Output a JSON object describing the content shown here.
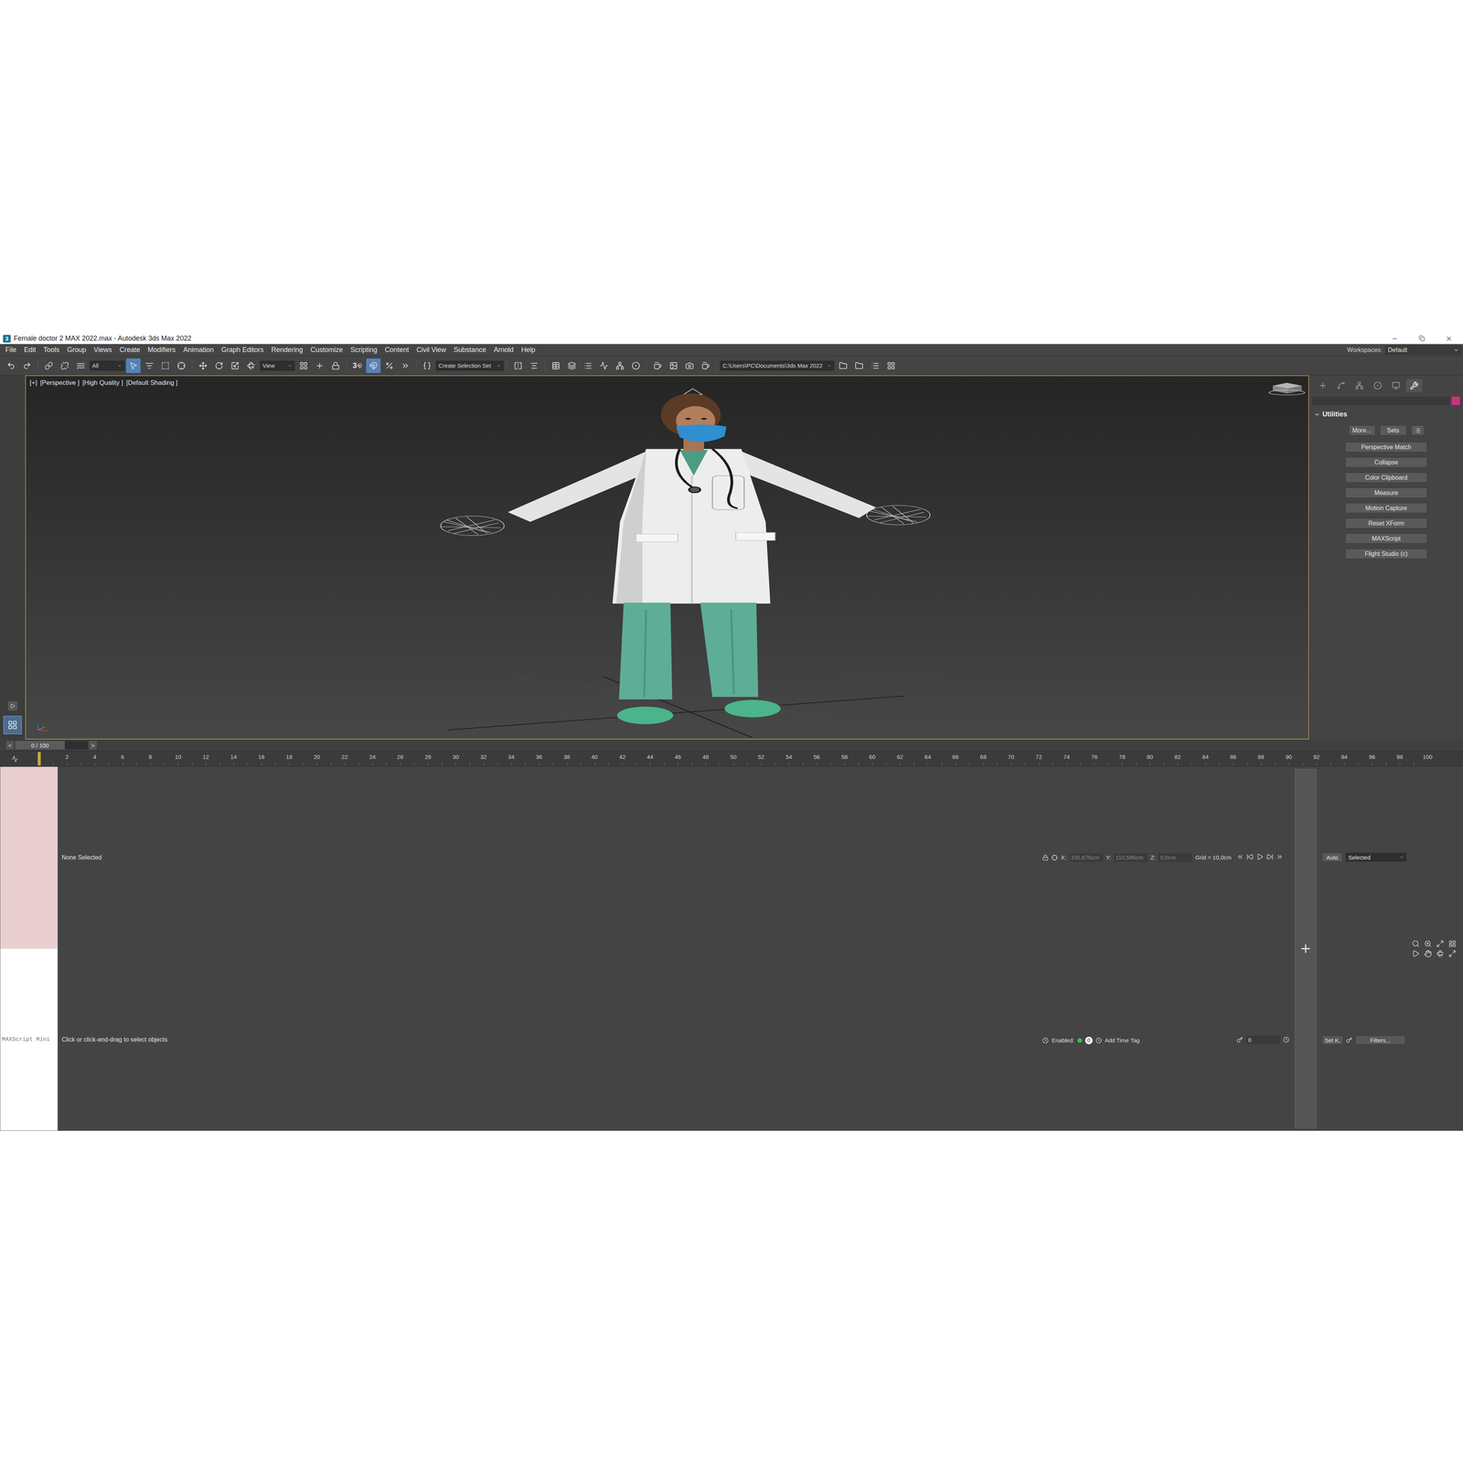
{
  "window": {
    "logo": "3",
    "title": "Female doctor 2 MAX 2022.max - Autodesk 3ds Max 2022"
  },
  "menu": [
    "File",
    "Edit",
    "Tools",
    "Group",
    "Views",
    "Create",
    "Modifiers",
    "Animation",
    "Graph Editors",
    "Rendering",
    "Customize",
    "Scripting",
    "Content",
    "Civil View",
    "Substance",
    "Arnold",
    "Help"
  ],
  "workspaces": {
    "label": "Workspaces:",
    "value": "Default"
  },
  "toolbar": {
    "selection_filter": "All",
    "reference_coord": "View",
    "snap_label": "3",
    "selection_set": "Create Selection Set",
    "project_path": "C:\\Users\\PC\\Documents\\3ds Max 2022"
  },
  "viewport": {
    "labels": [
      "[+]",
      "[Perspective ]",
      "[High Quality ]",
      "[Default Shading ]"
    ],
    "active": true
  },
  "command_panel": {
    "tabs": [
      {
        "selected": false
      },
      {
        "selected": false
      },
      {
        "selected": false
      },
      {
        "selected": false
      },
      {
        "selected": false
      },
      {
        "selected": true
      }
    ],
    "swatch": "#d1307c",
    "rollout": {
      "title": "Utilities",
      "expanded": true,
      "top_buttons": [
        "More...",
        "Sets"
      ],
      "buttons": [
        "Perspective Match",
        "Collapse",
        "Color Clipboard",
        "Measure",
        "Motion Capture",
        "Reset XForm",
        "MAXScript",
        "Flight Studio (c)"
      ]
    }
  },
  "time_slider": {
    "prev": "<",
    "label": "0 / 100",
    "next": ">",
    "level": 0
  },
  "track_bar": {
    "ticks": [
      "2",
      "4",
      "6",
      "8",
      "10",
      "12",
      "14",
      "16",
      "18",
      "20",
      "22",
      "24",
      "26",
      "28",
      "30",
      "32",
      "34",
      "36",
      "38",
      "40",
      "42",
      "44",
      "46",
      "48",
      "50",
      "52",
      "54",
      "56",
      "58",
      "60",
      "62",
      "64",
      "66",
      "68",
      "70",
      "72",
      "74",
      "76",
      "78",
      "80",
      "82",
      "84",
      "86",
      "88",
      "90",
      "92",
      "94",
      "96",
      "98",
      "100"
    ]
  },
  "status": {
    "maxscript": "MAXScript Mini",
    "selection": "None Selected",
    "prompt": "Click or click-and-drag to select objects",
    "coords": [
      {
        "label": "X:",
        "value": "335,676cm"
      },
      {
        "label": "Y:",
        "value": "110,586cm"
      },
      {
        "label": "Z:",
        "value": "0,0cm"
      }
    ],
    "grid": "Grid = 10,0cm",
    "enabled_label": "Enabled:",
    "enabled": true,
    "tag_count": "0",
    "time_tag": "Add Time Tag",
    "frame": "0",
    "auto_key": "Auto",
    "key_filter": "Selected",
    "set_key": "Set K.",
    "filters": "Filters..."
  }
}
